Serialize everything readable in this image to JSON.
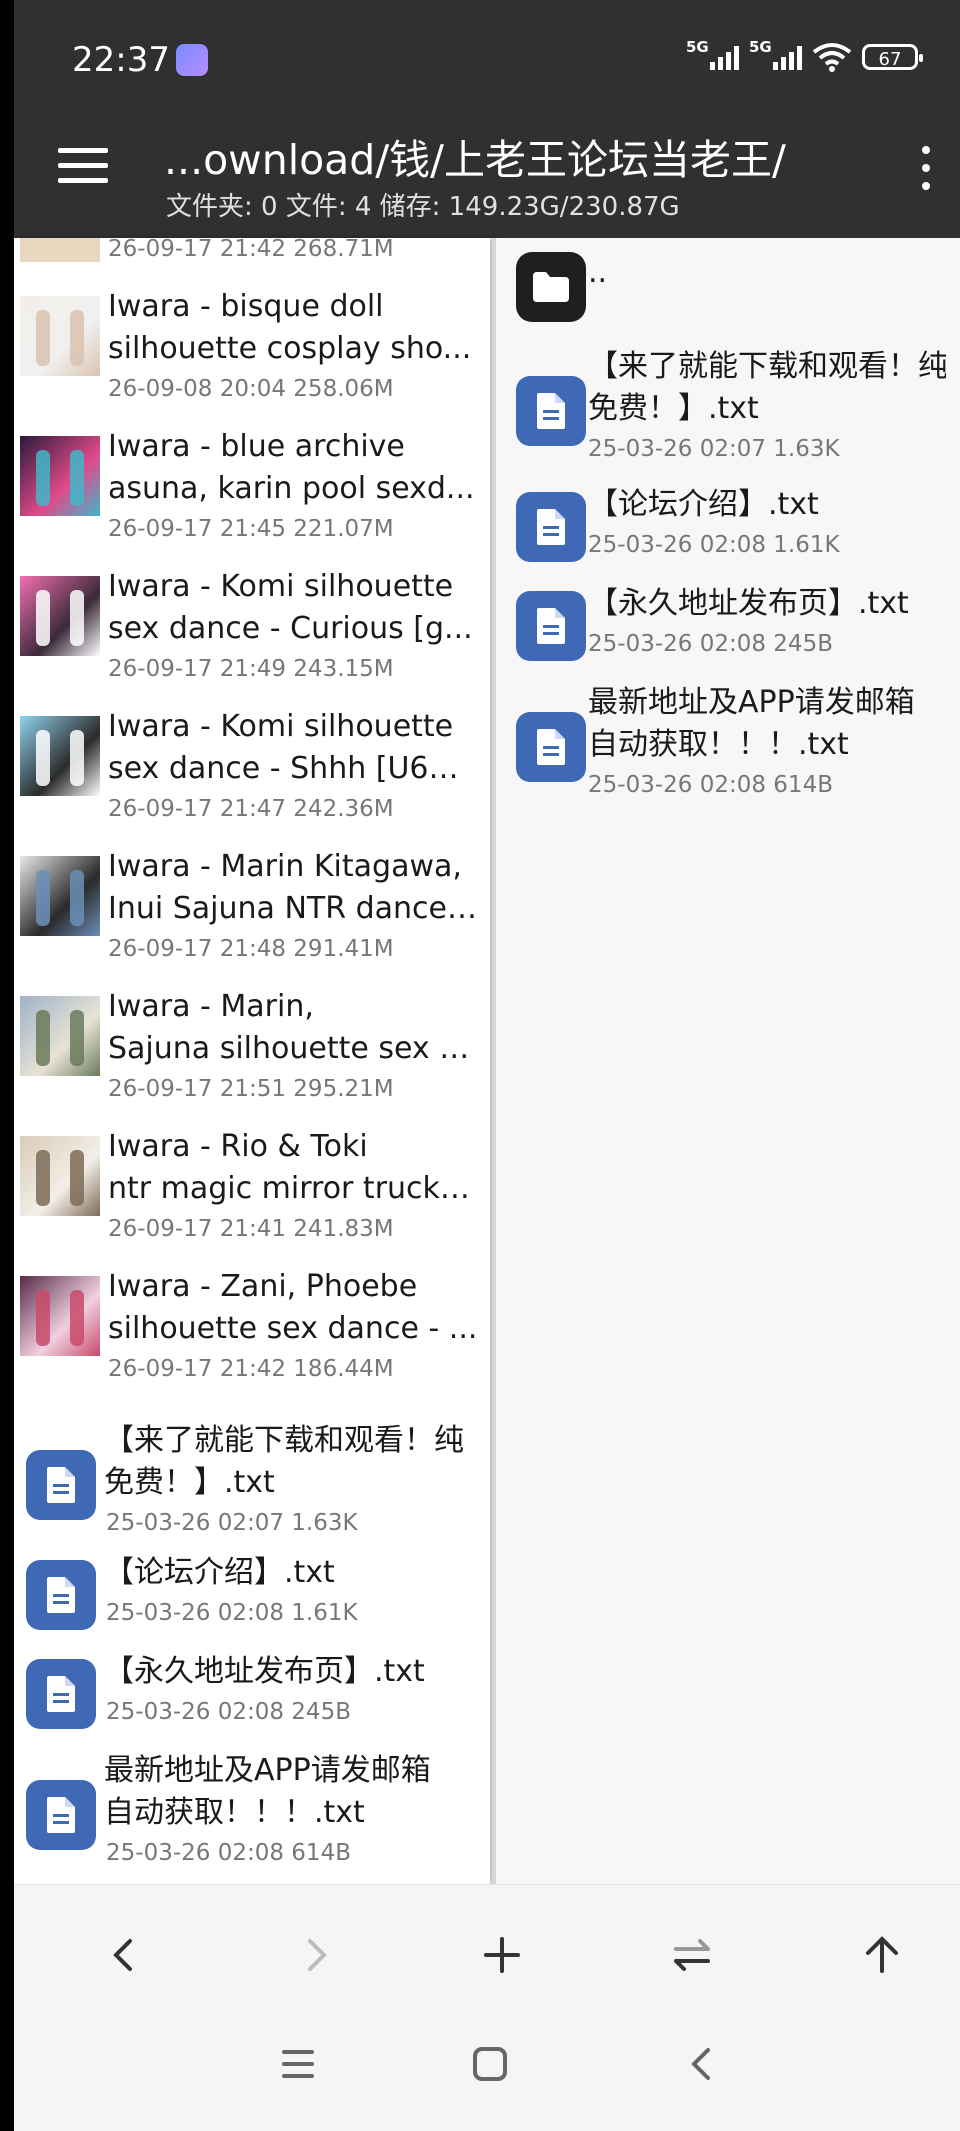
{
  "status_bar": {
    "time": "22:37",
    "network_1": "5G",
    "network_2": "5G",
    "battery": "67"
  },
  "app_bar": {
    "path": "...ownload/钱/上老王论坛当老王/",
    "info": "文件夹: 0  文件: 4  储存: 149.23G/230.87G",
    "menu_icon": "hamburger-icon",
    "more_icon": "more-vert-icon"
  },
  "left_pane": {
    "partial_item": {
      "meta": "26-09-17 21:42  268.71M"
    },
    "videos": [
      {
        "line1": "Iwara - bisque doll",
        "line2": "silhouette cosplay sho...",
        "meta": "26-09-08 20:04  258.06M",
        "thumb": [
          "#f2efe9",
          "#d9c3b0",
          "#f0f0f0"
        ]
      },
      {
        "line1": "Iwara - blue archive",
        "line2": "asuna, karin pool sexd...",
        "meta": "26-09-17 21:45  221.07M",
        "thumb": [
          "#2a1a3a",
          "#3fb7c9",
          "#e04a8a"
        ]
      },
      {
        "line1": "Iwara - Komi silhouette",
        "line2": "sex dance - Curious [g...",
        "meta": "26-09-17 21:49  243.15M",
        "thumb": [
          "#f36fb0",
          "#ffffff",
          "#3b2a3a"
        ]
      },
      {
        "line1": "Iwara - Komi silhouette",
        "line2": "sex dance - Shhh [U6H...",
        "meta": "26-09-17 21:47  242.36M",
        "thumb": [
          "#8fd3f0",
          "#ffffff",
          "#2b2b2b"
        ]
      },
      {
        "line1": "Iwara - Marin Kitagawa,",
        "line2": "Inui Sajuna NTR dance ...",
        "meta": "26-09-17 21:48  291.41M",
        "thumb": [
          "#e8e8e8",
          "#6b8fb8",
          "#2a2a2a"
        ]
      },
      {
        "line1": "Iwara - Marin,",
        "line2": "Sajuna silhouette sex d...",
        "meta": "26-09-17 21:51  295.21M",
        "thumb": [
          "#9fb2c6",
          "#6a7b5a",
          "#e7e2d6"
        ]
      },
      {
        "line1": "Iwara - Rio & Toki",
        "line2": "ntr magic mirror truck ...",
        "meta": "26-09-17 21:41  241.83M",
        "thumb": [
          "#d8cbb8",
          "#7d6b56",
          "#f3efe8"
        ]
      },
      {
        "line1": "Iwara - Zani, Phoebe",
        "line2": "silhouette sex dance - ...",
        "meta": "26-09-17 21:42  186.44M",
        "thumb": [
          "#5a2a4a",
          "#c84a6a",
          "#f0d0e0"
        ]
      }
    ],
    "files": [
      {
        "line1": "【来了就能下载和观看！纯",
        "line2": "免费！】.txt",
        "meta": "25-03-26 02:07  1.63K"
      },
      {
        "line1": "【论坛介绍】.txt",
        "line2": "",
        "meta": "25-03-26 02:08  1.61K"
      },
      {
        "line1": "【永久地址发布页】.txt",
        "line2": "",
        "meta": "25-03-26 02:08  245B"
      },
      {
        "line1": "最新地址及APP请发邮箱",
        "line2": "自动获取！！！.txt",
        "meta": "25-03-26 02:08  614B"
      }
    ]
  },
  "right_pane": {
    "parent_label": "..",
    "files": [
      {
        "line1": "【来了就能下载和观看！纯",
        "line2": "免费！】.txt",
        "meta": "25-03-26 02:07  1.63K"
      },
      {
        "line1": "【论坛介绍】.txt",
        "line2": "",
        "meta": "25-03-26 02:08  1.61K"
      },
      {
        "line1": "【永久地址发布页】.txt",
        "line2": "",
        "meta": "25-03-26 02:08  245B"
      },
      {
        "line1": "最新地址及APP请发邮箱",
        "line2": "自动获取！！！.txt",
        "meta": "25-03-26 02:08  614B"
      }
    ]
  },
  "toolbar": [
    "back-icon",
    "forward-icon",
    "add-icon",
    "swap-icon",
    "up-icon"
  ],
  "nav_bar": [
    "recents-icon",
    "home-icon",
    "back-icon"
  ]
}
